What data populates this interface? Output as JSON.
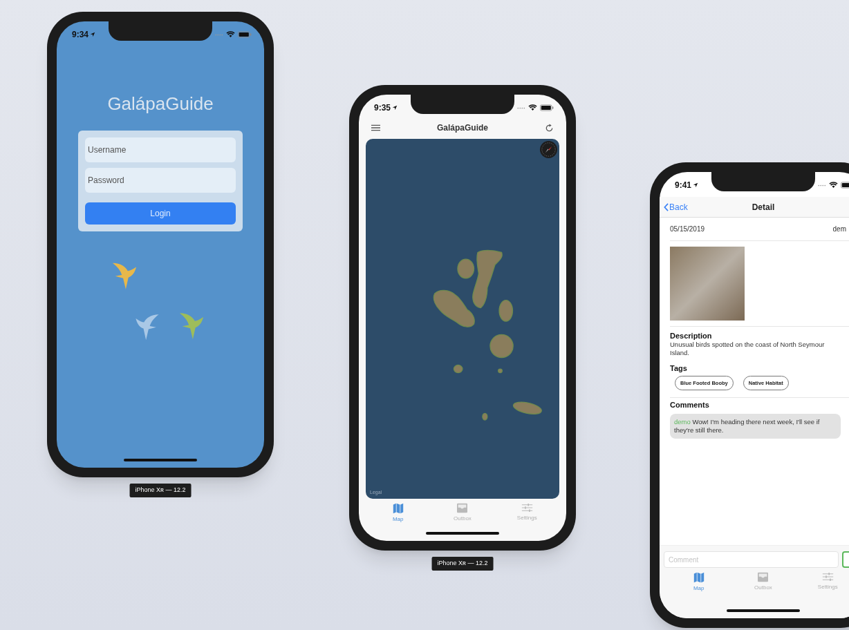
{
  "devices": [
    {
      "kind": "login",
      "status_time": "9:34",
      "app_title": "GalápaGuide",
      "username_placeholder": "Username",
      "password_placeholder": "Password",
      "login_button": "Login",
      "label": "iPhone Xʀ — 12.2"
    },
    {
      "kind": "map",
      "status_time": "9:35",
      "nav_title": "GalápaGuide",
      "map_legal": "Legal",
      "tabs": [
        {
          "label": "Map",
          "selected": true
        },
        {
          "label": "Outbox",
          "selected": false
        },
        {
          "label": "Settings",
          "selected": false
        }
      ],
      "label": "iPhone Xʀ — 12.2"
    },
    {
      "kind": "detail",
      "status_time": "9:41",
      "back": "Back",
      "nav_title": "Detail",
      "date": "05/15/2019",
      "user": "dem",
      "description_heading": "Description",
      "description": "Unusual birds spotted on the coast of North Seymour Island.",
      "tags_heading": "Tags",
      "tags": [
        "Blue Footed Booby",
        "Native Habitat"
      ],
      "comments_heading": "Comments",
      "comments": [
        {
          "author": "demo",
          "text": "Wow! I'm heading there next week, I'll see if they're still there."
        }
      ],
      "comment_placeholder": "Comment",
      "tabs": [
        {
          "label": "Map",
          "selected": true
        },
        {
          "label": "Outbox",
          "selected": false
        },
        {
          "label": "Settings",
          "selected": false
        }
      ]
    }
  ]
}
